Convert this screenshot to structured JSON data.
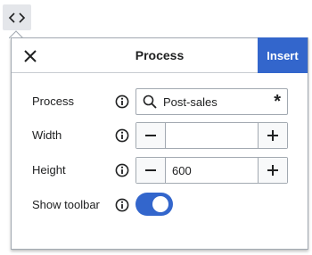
{
  "toolbar": {
    "code_icon": "code-brackets-icon"
  },
  "dialog": {
    "title": "Process",
    "close_icon": "close-icon",
    "insert_label": "Insert",
    "accent_color": "#3366cc"
  },
  "fields": {
    "process": {
      "label": "Process",
      "value": "Post-sales",
      "required_mark": "*",
      "icon": "search-icon"
    },
    "width": {
      "label": "Width",
      "value": "",
      "minus_label": "−",
      "plus_label": "+"
    },
    "height": {
      "label": "Height",
      "value": "600",
      "minus_label": "−",
      "plus_label": "+"
    },
    "show_toolbar": {
      "label": "Show toolbar",
      "on": true
    }
  }
}
